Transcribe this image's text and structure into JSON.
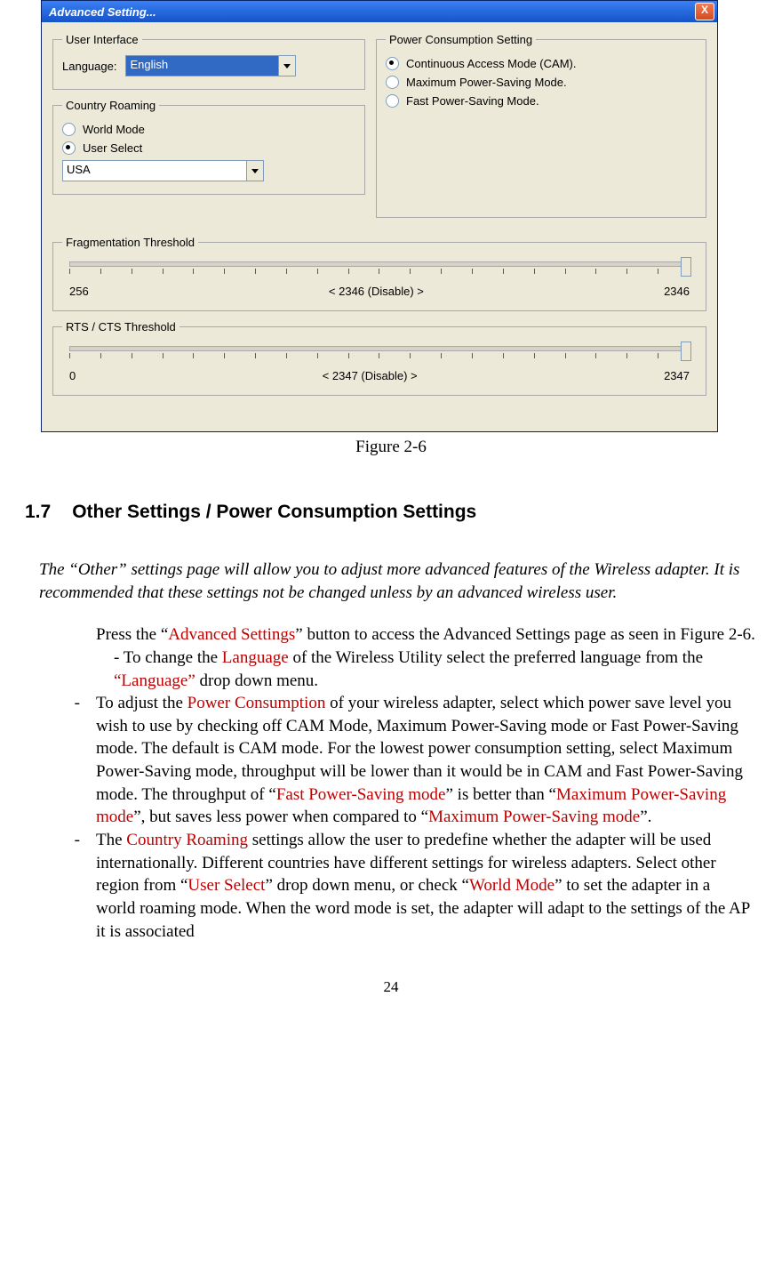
{
  "dialog": {
    "title": "Advanced Setting...",
    "close": "X",
    "user_interface": {
      "legend": "User Interface",
      "language_label": "Language:",
      "language_value": "English"
    },
    "country_roaming": {
      "legend": "Country Roaming",
      "world_mode": "World Mode",
      "user_select": "User Select",
      "country_value": "USA"
    },
    "power": {
      "legend": "Power Consumption Setting",
      "cam": "Continuous Access Mode (CAM).",
      "max": "Maximum Power-Saving Mode.",
      "fast": "Fast Power-Saving Mode."
    },
    "frag": {
      "legend": "Fragmentation Threshold",
      "min": "256",
      "mid": "< 2346 (Disable) >",
      "max": "2346"
    },
    "rts": {
      "legend": "RTS / CTS Threshold",
      "min": "0",
      "mid": "< 2347 (Disable) >",
      "max": "2347"
    }
  },
  "caption": "Figure 2-6",
  "section": {
    "num": "1.7",
    "title": "Other Settings / Power Consumption Settings"
  },
  "intro": "The “Other” settings page will allow you to adjust more advanced features of the Wireless adapter.    It is recommended that these settings not be changed unless by an advanced wireless user.",
  "p1a": "Press the “",
  "p1_red": "Advanced Settings",
  "p1b": "” button to access the Advanced Settings page as seen in Figure 2-6.",
  "b1a": "-    To change the ",
  "b1_red1": "Language",
  "b1b": " of the Wireless Utility select the preferred language from the ",
  "b1_red2": "“Language”",
  "b1c": " drop down menu.",
  "b2": {
    "bullet": "-",
    "a": "To adjust the ",
    "r1": "Power Consumption",
    "b": " of your wireless adapter, select which power save level you wish to use by checking off CAM Mode, Maximum Power-Saving mode or Fast Power-Saving mode. The default is CAM mode. For the lowest power consumption setting, select Maximum Power-Saving mode, throughput will be lower than it would be in CAM and Fast Power-Saving mode. The throughput of    “",
    "r2": "Fast Power-Saving mode",
    "c": "” is better than “",
    "r3": "Maximum Power-Saving mode",
    "d": "”, but saves less power when compared to “",
    "r4": "Maximum Power-Saving mode",
    "e": "”."
  },
  "b3": {
    "bullet": "-",
    "a": "The ",
    "r1": "Country Roaming",
    "b": " settings allow the user to predefine whether the adapter will be used internationally.    Different countries have different settings for wireless adapters.    Select other region from “",
    "r2": "User Select",
    "c": "” drop down menu, or check “",
    "r3": "World Mode",
    "d": "” to set the adapter in a world roaming mode. When the word mode is set, the adapter will adapt to the settings of the AP it is associated"
  },
  "page_number": "24"
}
